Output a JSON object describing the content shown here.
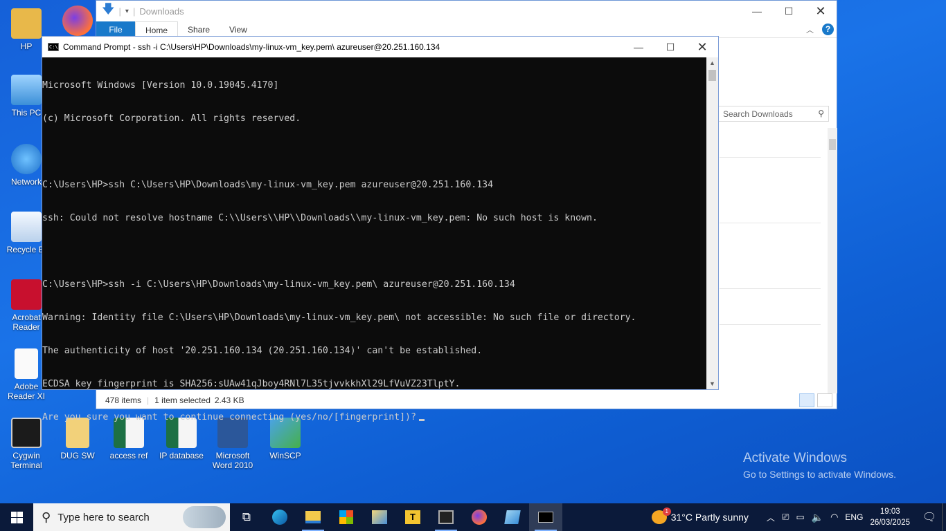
{
  "desktop_icons": [
    {
      "label": "HP"
    },
    {
      "label": "This PC"
    },
    {
      "label": "Network"
    },
    {
      "label": "Recycle Bi"
    },
    {
      "label": "Acrobat Reader"
    },
    {
      "label": "Adobe Reader XI"
    },
    {
      "label": "Cygwin Terminal"
    },
    {
      "label": "DUG SW"
    },
    {
      "label": "access ref"
    },
    {
      "label": "IP database"
    },
    {
      "label": "Microsoft Word 2010"
    },
    {
      "label": "WinSCP"
    }
  ],
  "explorer": {
    "title": "Downloads",
    "tabs": [
      "File",
      "Home",
      "Share",
      "View"
    ],
    "search_placeholder": "Search Downloads",
    "status_items": "478 items",
    "status_selected": "1 item selected",
    "status_size": "2.43 KB"
  },
  "cmd": {
    "title": "Command Prompt - ssh  -i C:\\Users\\HP\\Downloads\\my-linux-vm_key.pem\\ azureuser@20.251.160.134",
    "lines": [
      "Microsoft Windows [Version 10.0.19045.4170]",
      "(c) Microsoft Corporation. All rights reserved.",
      "",
      "C:\\Users\\HP>ssh C:\\Users\\HP\\Downloads\\my-linux-vm_key.pem azureuser@20.251.160.134",
      "ssh: Could not resolve hostname C:\\\\Users\\\\HP\\\\Downloads\\\\my-linux-vm_key.pem: No such host is known.",
      "",
      "C:\\Users\\HP>ssh -i C:\\Users\\HP\\Downloads\\my-linux-vm_key.pem\\ azureuser@20.251.160.134",
      "Warning: Identity file C:\\Users\\HP\\Downloads\\my-linux-vm_key.pem\\ not accessible: No such file or directory.",
      "The authenticity of host '20.251.160.134 (20.251.160.134)' can't be established.",
      "ECDSA key fingerprint is SHA256:sUAw41qJboy4RNl7L35tjvvkkhXl29LfVuVZ23TlptY.",
      "Are you sure you want to continue connecting (yes/no/[fingerprint])?"
    ]
  },
  "watermark": {
    "title": "Activate Windows",
    "subtitle": "Go to Settings to activate Windows."
  },
  "taskbar": {
    "search_placeholder": "Type here to search",
    "weather": "31°C  Partly sunny",
    "weather_badge": "1",
    "language": "ENG",
    "time": "19:03",
    "date": "26/03/2025"
  },
  "colors": {
    "accent": "#1979ca",
    "console_bg": "#0c0c0c",
    "console_fg": "#cccccc",
    "taskbar": "#0b1a3a"
  }
}
